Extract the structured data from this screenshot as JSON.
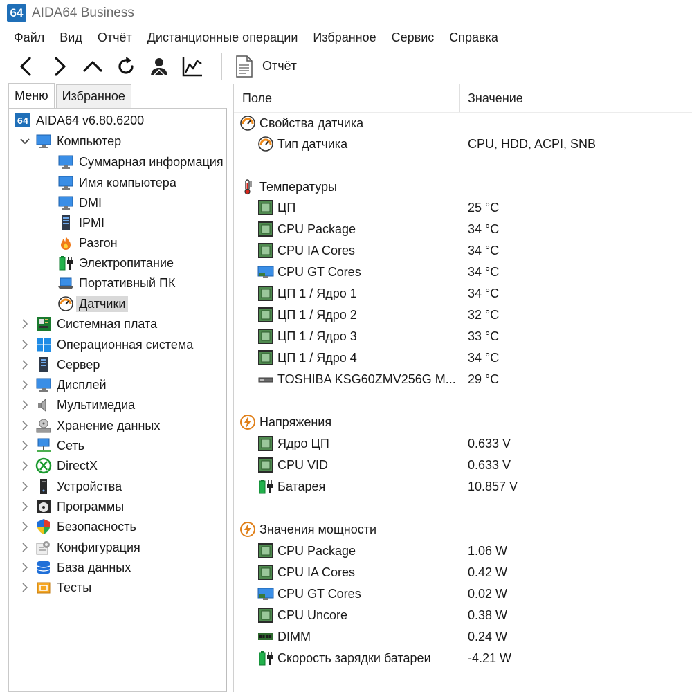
{
  "app": {
    "logo": "64",
    "title": "AIDA64 Business"
  },
  "menu": [
    "Файл",
    "Вид",
    "Отчёт",
    "Дистанционные операции",
    "Избранное",
    "Сервис",
    "Справка"
  ],
  "toolbar": {
    "icons": [
      "back-arrow-icon",
      "forward-arrow-icon",
      "up-arrow-icon",
      "refresh-icon",
      "user-icon",
      "chart-icon"
    ],
    "report_label": "Отчёт"
  },
  "left": {
    "tabs": [
      "Меню",
      "Избранное"
    ],
    "root": {
      "logo": "64",
      "label": "AIDA64 v6.80.6200"
    },
    "computer": "Компьютер",
    "computer_children": [
      "Суммарная информация",
      "Имя компьютера",
      "DMI",
      "IPMI",
      "Разгон",
      "Электропитание",
      "Портативный ПК",
      "Датчики"
    ],
    "categories": [
      "Системная плата",
      "Операционная система",
      "Сервер",
      "Дисплей",
      "Мультимедиа",
      "Хранение данных",
      "Сеть",
      "DirectX",
      "Устройства",
      "Программы",
      "Безопасность",
      "Конфигурация",
      "База данных",
      "Тесты"
    ]
  },
  "right": {
    "columns": {
      "field": "Поле",
      "value": "Значение"
    },
    "groups": [
      {
        "title": "Свойства датчика",
        "icon": "sensor-gauge-icon",
        "items": [
          {
            "field": "Тип датчика",
            "value": "CPU, HDD, ACPI, SNB",
            "icon": "sensor-gauge-icon"
          }
        ]
      },
      {
        "title": "Температуры",
        "icon": "thermometer-icon",
        "items": [
          {
            "field": "ЦП",
            "value": "25 °C",
            "icon": "cpu-chip-icon"
          },
          {
            "field": "CPU Package",
            "value": "34 °C",
            "icon": "cpu-chip-icon"
          },
          {
            "field": "CPU IA Cores",
            "value": "34 °C",
            "icon": "cpu-chip-icon"
          },
          {
            "field": "CPU GT Cores",
            "value": "34 °C",
            "icon": "gpu-monitor-icon"
          },
          {
            "field": "ЦП 1 / Ядро 1",
            "value": "34 °C",
            "icon": "cpu-chip-icon"
          },
          {
            "field": "ЦП 1 / Ядро 2",
            "value": "32 °C",
            "icon": "cpu-chip-icon"
          },
          {
            "field": "ЦП 1 / Ядро 3",
            "value": "33 °C",
            "icon": "cpu-chip-icon"
          },
          {
            "field": "ЦП 1 / Ядро 4",
            "value": "34 °C",
            "icon": "cpu-chip-icon"
          },
          {
            "field": "TOSHIBA KSG60ZMV256G M...",
            "value": "29 °C",
            "icon": "drive-icon"
          }
        ]
      },
      {
        "title": "Напряжения",
        "icon": "lightning-icon",
        "items": [
          {
            "field": "Ядро ЦП",
            "value": "0.633 V",
            "icon": "cpu-chip-icon"
          },
          {
            "field": "CPU VID",
            "value": "0.633 V",
            "icon": "cpu-chip-icon"
          },
          {
            "field": "Батарея",
            "value": "10.857 V",
            "icon": "battery-icon"
          }
        ]
      },
      {
        "title": "Значения мощности",
        "icon": "lightning-icon",
        "items": [
          {
            "field": "CPU Package",
            "value": "1.06 W",
            "icon": "cpu-chip-icon"
          },
          {
            "field": "CPU IA Cores",
            "value": "0.42 W",
            "icon": "cpu-chip-icon"
          },
          {
            "field": "CPU GT Cores",
            "value": "0.02 W",
            "icon": "gpu-monitor-icon"
          },
          {
            "field": "CPU Uncore",
            "value": "0.38 W",
            "icon": "cpu-chip-icon"
          },
          {
            "field": "DIMM",
            "value": "0.24 W",
            "icon": "memory-module-icon"
          },
          {
            "field": "Скорость зарядки батареи",
            "value": "-4.21 W",
            "icon": "battery-icon"
          }
        ]
      }
    ]
  }
}
